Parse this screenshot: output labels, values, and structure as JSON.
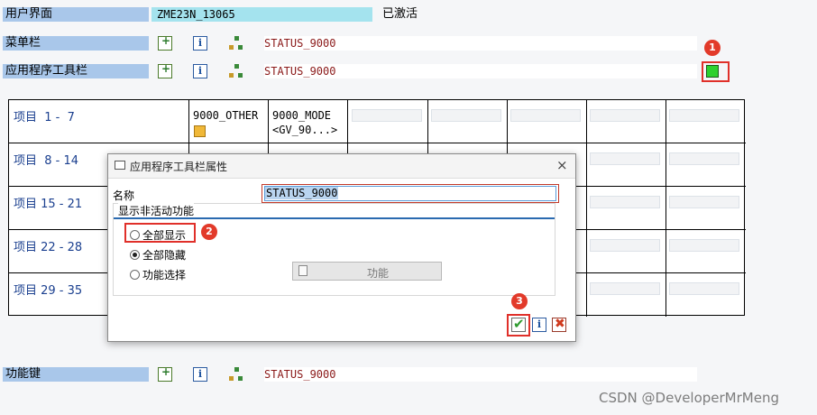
{
  "header": {
    "user_interface_label": "用户界面",
    "program_name": "ZME23N_13065",
    "status_text": "已激活"
  },
  "rows": {
    "menu_bar": {
      "label": "菜单栏",
      "status": "STATUS_9000"
    },
    "app_toolbar": {
      "label": "应用程序工具栏",
      "status": "STATUS_9000"
    },
    "function_keys": {
      "label": "功能键",
      "status": "STATUS_9000"
    }
  },
  "grid": {
    "row_labels": [
      "项目  1 -  7",
      "项目  8 - 14",
      "项目 15 - 21",
      "项目 22 - 28",
      "项目 29 - 35"
    ],
    "cell_a_line1": "9000_OTHER",
    "cell_b_line1": "9000_MODE",
    "cell_b_line2": "<GV_90...>"
  },
  "dialog": {
    "title": "应用程序工具栏属性",
    "name_label": "名称",
    "name_value": "STATUS_9000",
    "section_title": "显示非活动功能",
    "options": [
      "全部显示",
      "全部隐藏",
      "功能选择"
    ],
    "selected_option": "全部隐藏",
    "function_button_label": "功能"
  },
  "badges": [
    "1",
    "2",
    "3"
  ],
  "watermark": "CSDN @DeveloperMrMeng",
  "colors": {
    "label_bg": "#a9c7ea",
    "program_bg": "#a4e3ee",
    "status_text": "#8b1a1a",
    "highlight_red": "#e0302a",
    "confirm_green": "#2e9a2e"
  }
}
